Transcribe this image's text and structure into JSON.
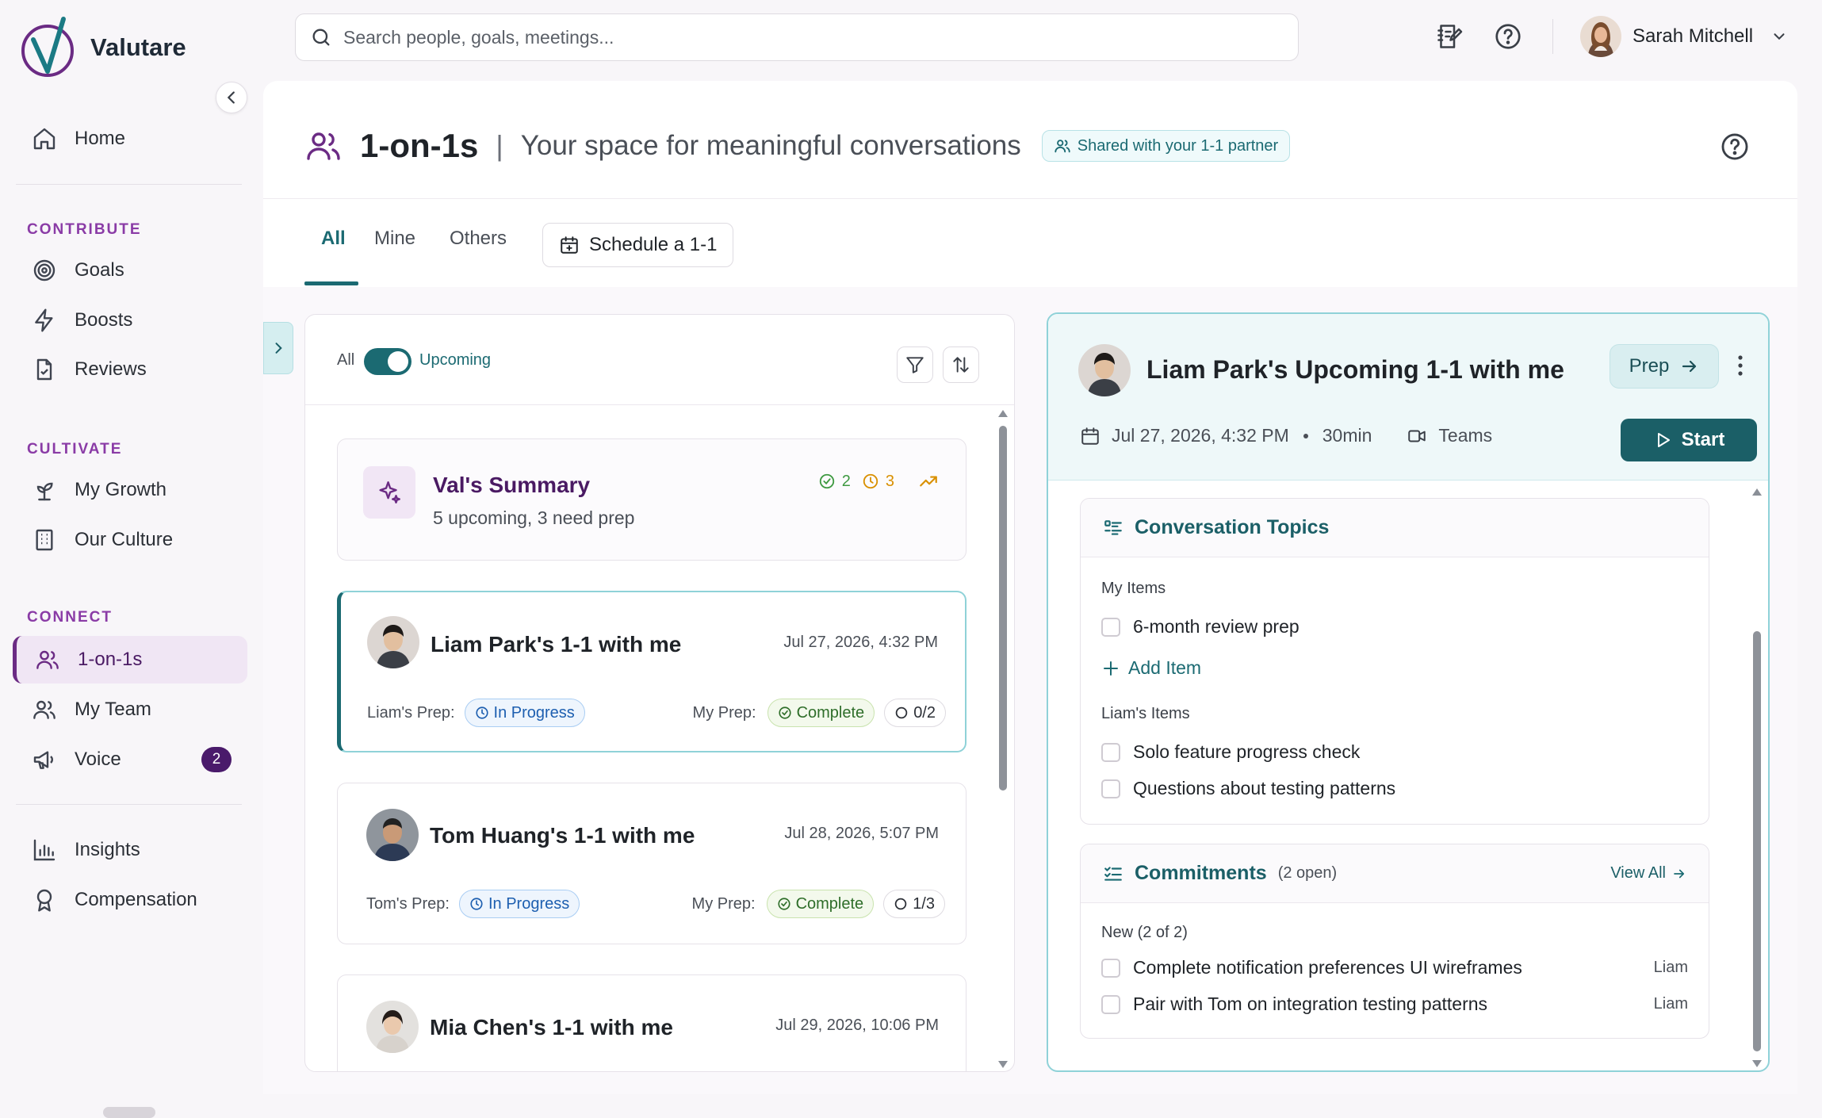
{
  "app": {
    "name": "Valutare"
  },
  "search": {
    "placeholder": "Search people, goals, meetings..."
  },
  "user": {
    "name": "Sarah Mitchell"
  },
  "sidebar": {
    "home": "Home",
    "sections": {
      "contribute": "CONTRIBUTE",
      "cultivate": "CULTIVATE",
      "connect": "CONNECT"
    },
    "items": {
      "goals": "Goals",
      "boosts": "Boosts",
      "reviews": "Reviews",
      "my_growth": "My Growth",
      "our_culture": "Our Culture",
      "one_on_ones": "1-on-1s",
      "my_team": "My Team",
      "voice": "Voice",
      "insights": "Insights",
      "compensation": "Compensation"
    },
    "voice_badge": "2"
  },
  "page": {
    "title": "1-on-1s",
    "separator": "|",
    "subtitle": "Your space for meaningful conversations",
    "shared_badge": "Shared with your 1-1 partner"
  },
  "tabs": {
    "all": "All",
    "mine": "Mine",
    "others": "Others",
    "schedule": "Schedule a 1-1"
  },
  "list": {
    "filter_all": "All",
    "filter_upcoming": "Upcoming",
    "summary": {
      "title": "Val's Summary",
      "subtitle": "5 upcoming, 3 need prep",
      "done_count": "2",
      "pending_count": "3"
    },
    "meetings": [
      {
        "title": "Liam Park's 1-1 with me",
        "date": "Jul 27, 2026, 4:32 PM",
        "partner_prep_label": "Liam's Prep:",
        "partner_prep": "In Progress",
        "my_prep_label": "My Prep:",
        "my_prep": "Complete",
        "count": "0/2"
      },
      {
        "title": "Tom Huang's 1-1 with me",
        "date": "Jul 28, 2026, 5:07 PM",
        "partner_prep_label": "Tom's Prep:",
        "partner_prep": "In Progress",
        "my_prep_label": "My Prep:",
        "my_prep": "Complete",
        "count": "1/3"
      },
      {
        "title": "Mia Chen's 1-1 with me",
        "date": "Jul 29, 2026, 10:06 PM"
      }
    ]
  },
  "detail": {
    "title": "Liam Park's Upcoming 1-1 with me",
    "prep_button": "Prep",
    "date": "Jul 27, 2026, 4:32 PM",
    "duration": "30min",
    "platform": "Teams",
    "start_button": "Start",
    "topics": {
      "title": "Conversation Topics",
      "my_items_label": "My Items",
      "my_items": [
        "6-month review prep"
      ],
      "add_item": "Add Item",
      "partner_items_label": "Liam's Items",
      "partner_items": [
        "Solo feature progress check",
        "Questions about testing patterns"
      ]
    },
    "commitments": {
      "title": "Commitments",
      "open_count": "(2 open)",
      "view_all": "View All",
      "new_label": "New (2 of 2)",
      "items": [
        {
          "text": "Complete notification preferences UI wireframes",
          "owner": "Liam"
        },
        {
          "text": "Pair with Tom on integration testing patterns",
          "owner": "Liam"
        }
      ]
    }
  },
  "colors": {
    "brand_purple": "#6b2b84",
    "teal": "#1b6a72",
    "badge_purple": "#4a1a6b"
  }
}
